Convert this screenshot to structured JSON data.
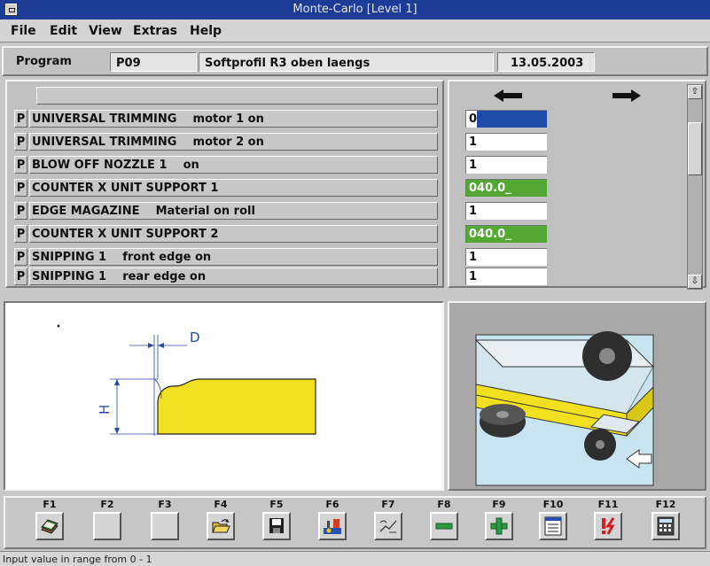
{
  "window": {
    "title": "Monte-Carlo [Level 1]"
  },
  "menu": [
    "File",
    "Edit",
    "View",
    "Extras",
    "Help"
  ],
  "program": {
    "label": "Program",
    "code": "P09",
    "name": "Softprofil R3 oben laengs",
    "date": "13.05.2003"
  },
  "steps": [
    {
      "type": "P",
      "text": "UNIVERSAL TRIMMING    motor 1 on",
      "value": "0"
    },
    {
      "type": "P",
      "text": "UNIVERSAL TRIMMING    motor 2 on",
      "value": "1"
    },
    {
      "type": "P",
      "text": "BLOW OFF NOZZLE 1    on",
      "value": "1"
    },
    {
      "type": "P",
      "text": "COUNTER X UNIT SUPPORT 1",
      "value": "040.0_"
    },
    {
      "type": "P",
      "text": "EDGE MAGAZINE    Material on roll",
      "value": "1"
    },
    {
      "type": "P",
      "text": "COUNTER X UNIT SUPPORT 2",
      "value": "040.0_"
    },
    {
      "type": "P",
      "text": "SNIPPING 1    front edge on",
      "value": "1"
    },
    {
      "type": "P",
      "text": "SNIPPING 1    rear edge on",
      "value": "1"
    }
  ],
  "drawing": {
    "dim_d": "D",
    "dim_h": "H"
  },
  "fkeys": [
    {
      "label": "F1",
      "icon": "book-icon"
    },
    {
      "label": "F2",
      "icon": "blank"
    },
    {
      "label": "F3",
      "icon": "blank"
    },
    {
      "label": "F4",
      "icon": "open-folder-icon"
    },
    {
      "label": "F5",
      "icon": "floppy-disk-icon"
    },
    {
      "label": "F6",
      "icon": "machine-tool-icon"
    },
    {
      "label": "F7",
      "icon": "edit-sequence-icon"
    },
    {
      "label": "F8",
      "icon": "minus-icon"
    },
    {
      "label": "F9",
      "icon": "plus-icon"
    },
    {
      "label": "F10",
      "icon": "list-window-icon"
    },
    {
      "label": "F11",
      "icon": "warning-icon"
    },
    {
      "label": "F12",
      "icon": "calculator-icon"
    }
  ],
  "status": "Input value in range from 0 - 1",
  "colors": {
    "title_bar": "#1e3c96",
    "value_green": "#52a832",
    "value_selected": "#1e4aa8",
    "profile_yellow": "#f0e020"
  }
}
